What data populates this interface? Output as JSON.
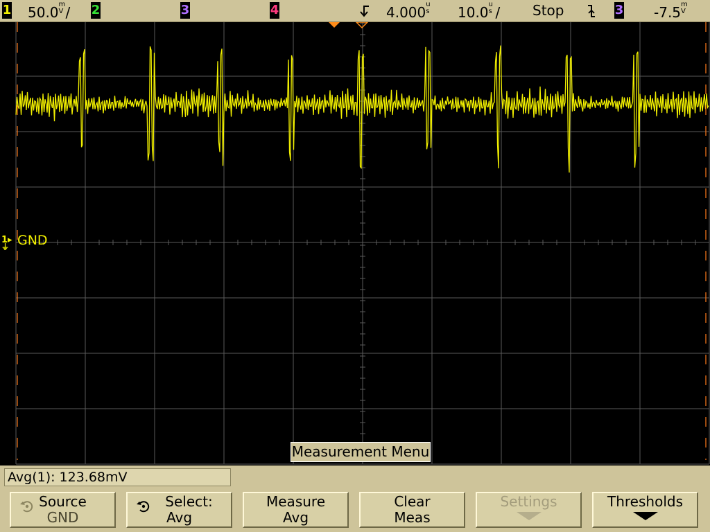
{
  "status_bar": {
    "ch1": {
      "label": "1",
      "color": "#f2f000",
      "scale": "50.0",
      "unit_top": "m",
      "unit_bottom": "V",
      "suffix": "/"
    },
    "ch2": {
      "label": "2",
      "color": "#36e236"
    },
    "ch3": {
      "label": "3",
      "color": "#b070ff"
    },
    "ch4": {
      "label": "4",
      "color": "#ff3a7e"
    },
    "delay": {
      "value": "4.000",
      "unit_top": "u",
      "unit_bottom": "s"
    },
    "timebase": {
      "value": "10.0",
      "unit_top": "u",
      "unit_bottom": "s",
      "suffix": "/"
    },
    "run_state": "Stop",
    "trigger_slope_icon": "falling-edge-icon",
    "trigger_source": {
      "label": "3",
      "color": "#b070ff"
    },
    "trigger_level": {
      "value": "-7.5",
      "unit_top": "m",
      "unit_bottom": "V"
    }
  },
  "screen": {
    "ground_label": "GND",
    "ground_marker": "1",
    "trace_color": "#f2f000",
    "grid_color": "#5a5a5a",
    "trigger_marker_color": "#ff8c1a",
    "menu_title": "Measurement Menu"
  },
  "measurement": {
    "readout": "Avg(1): 123.68mV"
  },
  "softkeys": [
    {
      "line1": "Source",
      "line2": "GND",
      "enabled": true,
      "icon": "rotary-knob-icon"
    },
    {
      "line1": "Select:",
      "line2": "Avg",
      "enabled": true,
      "icon": "rotary-knob-icon"
    },
    {
      "line1": "Measure",
      "line2": "Avg",
      "enabled": true
    },
    {
      "line1": "Clear",
      "line2": "Meas",
      "enabled": true
    },
    {
      "line1": "Settings",
      "enabled": false,
      "icon": "down-arrow-icon"
    },
    {
      "line1": "Thresholds",
      "enabled": true,
      "icon": "down-arrow-icon"
    }
  ]
}
